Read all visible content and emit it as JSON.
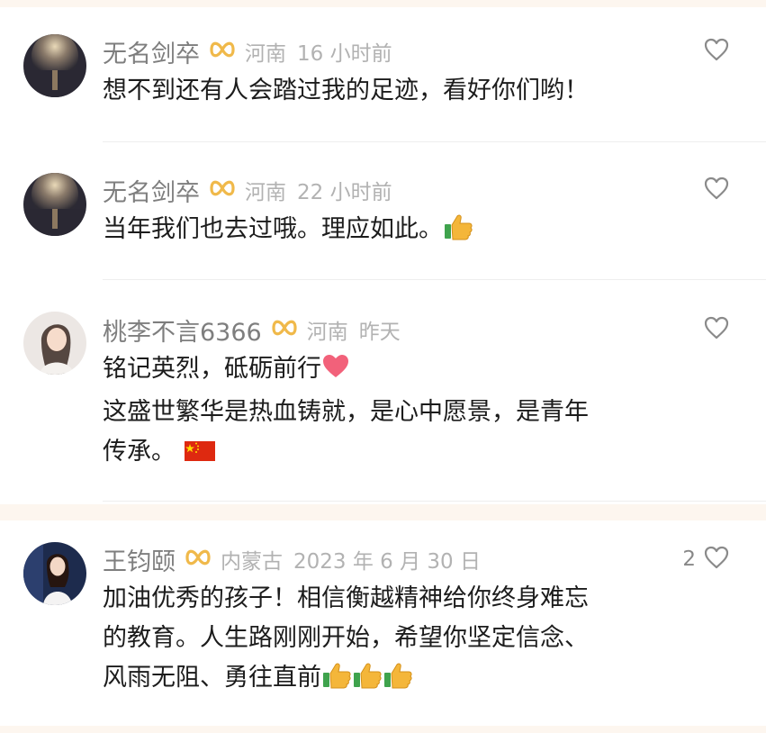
{
  "comments": [
    {
      "username": "无名剑卒",
      "location": "河南",
      "time": "16 小时前",
      "lines": [
        "想不到还有人会踏过我的足迹，看好你们哟！"
      ],
      "like_count": ""
    },
    {
      "username": "无名剑卒",
      "location": "河南",
      "time": "22 小时前",
      "lines": [
        "当年我们也去过哦。理应如此。"
      ],
      "like_count": ""
    },
    {
      "username": "桃李不言6366",
      "location": "河南",
      "time": "昨天",
      "lines": [
        "铭记英烈，砥砺前行",
        "这盛世繁华是热血铸就，是心中愿景，是青年",
        "传承。"
      ],
      "like_count": ""
    },
    {
      "username": "王钧颐",
      "location": "内蒙古",
      "time": "2023 年 6 月 30 日",
      "lines": [
        "加油优秀的孩子！相信衡越精神给你终身难忘",
        "的教育。人生路刚刚开始，希望你坚定信念、",
        "风雨无阻、勇往直前"
      ],
      "like_count": "2"
    }
  ],
  "icons": {
    "badge": "infinity-badge-icon",
    "like": "heart-outline-icon",
    "thumbs": "thumbs-up-emoji",
    "heart_emoji": "pink-heart-emoji",
    "flag": "china-flag-emoji"
  },
  "colors": {
    "badge": "#f0b94a",
    "thumbs": "#f4b63a",
    "heart_emoji": "#f2617a",
    "flag": "#de2910"
  }
}
